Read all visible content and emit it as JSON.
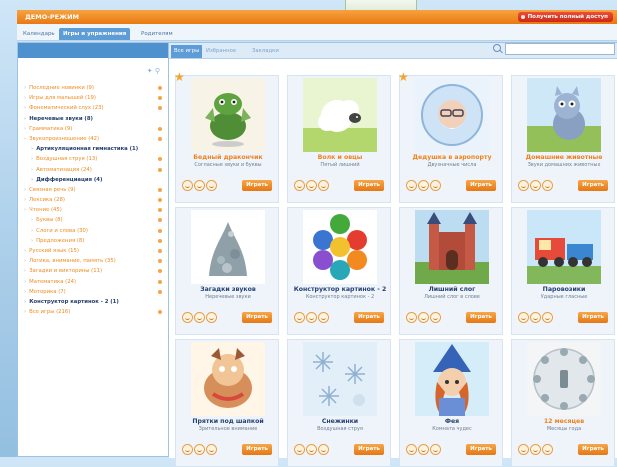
{
  "app": {
    "mode_title": "ДЕМО-РЕЖИМ",
    "full_access_label": "Получить полный доступ"
  },
  "top_tabs": [
    "Календарь",
    "Игры и упражнения",
    "Родителям"
  ],
  "content_tabs": [
    "Все игры",
    "Избранное",
    "Закладки"
  ],
  "sidebar": {
    "items": [
      {
        "label": "Последние новинки (9)",
        "level": 0,
        "dark": false
      },
      {
        "label": "Игры для малышей (19)",
        "level": 0,
        "dark": false
      },
      {
        "label": "Фонематический слух (23)",
        "level": 0,
        "dark": false
      },
      {
        "label": "Неречевые звуки (8)",
        "level": 0,
        "dark": true
      },
      {
        "label": "Грамматика (9)",
        "level": 0,
        "dark": false
      },
      {
        "label": "Звукопроизношение (42)",
        "level": 0,
        "dark": false
      },
      {
        "label": "Артикуляционная гимнастика (1)",
        "level": 1,
        "dark": true
      },
      {
        "label": "Воздушная струя (13)",
        "level": 1,
        "dark": false
      },
      {
        "label": "Автоматизация (24)",
        "level": 1,
        "dark": false
      },
      {
        "label": "Дифференциация (4)",
        "level": 1,
        "dark": true
      },
      {
        "label": "Связная речь (9)",
        "level": 0,
        "dark": false
      },
      {
        "label": "Лексика (28)",
        "level": 0,
        "dark": false
      },
      {
        "label": "Чтение (45)",
        "level": 0,
        "dark": false
      },
      {
        "label": "Буквы (8)",
        "level": 1,
        "dark": false
      },
      {
        "label": "Слоги и слова (30)",
        "level": 1,
        "dark": false
      },
      {
        "label": "Предложения (8)",
        "level": 1,
        "dark": false
      },
      {
        "label": "Русский язык (15)",
        "level": 0,
        "dark": false
      },
      {
        "label": "Логика, внимание, память (35)",
        "level": 0,
        "dark": false
      },
      {
        "label": "Загадки и викторины (11)",
        "level": 0,
        "dark": false
      },
      {
        "label": "Математика (24)",
        "level": 0,
        "dark": false
      },
      {
        "label": "Моторика (7)",
        "level": 0,
        "dark": false
      },
      {
        "label": "Конструктор картинок - 2 (1)",
        "level": 0,
        "dark": true
      },
      {
        "label": "Все игры (216)",
        "level": 0,
        "dark": false
      }
    ]
  },
  "play_label": "Играть",
  "cards": [
    {
      "title": "Бедный дракончик",
      "subtitle": "Согласные звуки и буквы",
      "dark": false,
      "star": true
    },
    {
      "title": "Волк и овцы",
      "subtitle": "Пятый лишний",
      "dark": false,
      "star": false
    },
    {
      "title": "Дедушка в аэропорту",
      "subtitle": "Двузначные числа",
      "dark": false,
      "star": true
    },
    {
      "title": "Домашние животные",
      "subtitle": "Звуки домашних животных",
      "dark": false,
      "star": false
    },
    {
      "title": "Загадки звуков",
      "subtitle": "Неречевые звуки",
      "dark": true,
      "star": false
    },
    {
      "title": "Конструктор картинок - 2",
      "subtitle": "Конструктор картинок - 2",
      "dark": true,
      "star": false
    },
    {
      "title": "Лишний слог",
      "subtitle": "Лишний слог в слове",
      "dark": true,
      "star": false
    },
    {
      "title": "Паровозики",
      "subtitle": "Ударные гласные",
      "dark": true,
      "star": false
    },
    {
      "title": "Прятки под шапкой",
      "subtitle": "Зрительное внимание",
      "dark": true,
      "star": false
    },
    {
      "title": "Снежинки",
      "subtitle": "Воздушная струя",
      "dark": true,
      "star": false
    },
    {
      "title": "Фея",
      "subtitle": "Комната чудес",
      "dark": true,
      "star": false
    },
    {
      "title": "12 месяцев",
      "subtitle": "Месяцы года",
      "dark": false,
      "star": false
    }
  ]
}
